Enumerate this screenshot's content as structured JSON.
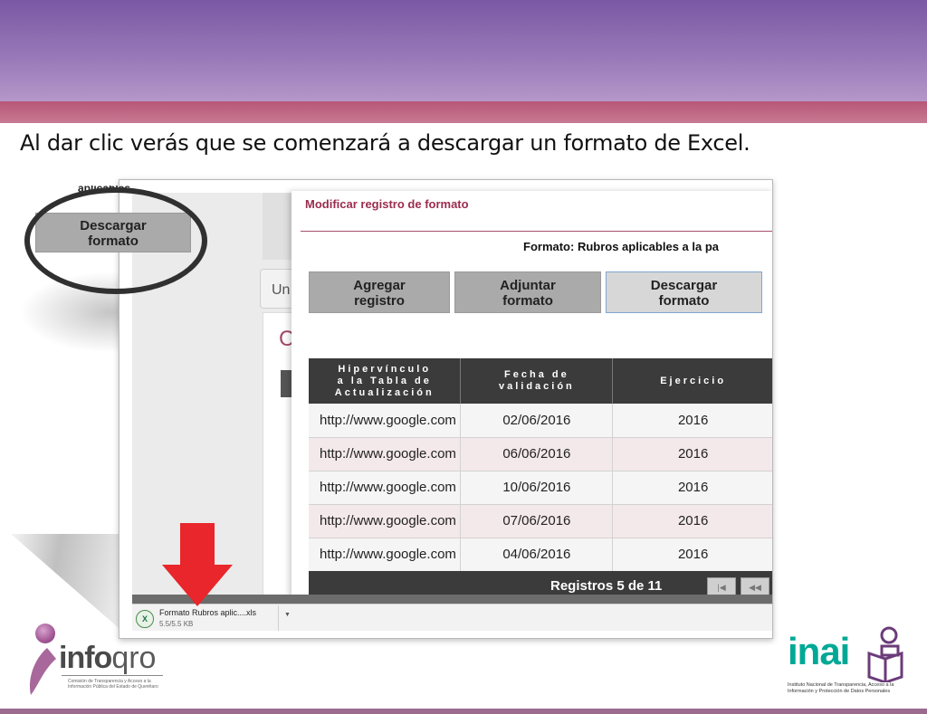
{
  "caption": "Al dar clic verás que se comenzará a descargar un formato de Excel.",
  "background_app": {
    "tab_label": "Un",
    "panel_heading_fragment": "C"
  },
  "zoom_callout": {
    "cut_text": "aplicables",
    "button_label": "Descargar\nformato"
  },
  "modal": {
    "title": "Modificar registro de formato",
    "format_label": "Formato: Rubros aplicables a la pa",
    "buttons": {
      "add": "Agregar\nregistro",
      "attach": "Adjuntar\nformato",
      "download": "Descargar\nformato"
    },
    "table": {
      "headers": [
        "Hipervínculo\na la Tabla de\nActualización",
        "Fecha de\nvalidación",
        "Ejercicio"
      ],
      "rows": [
        [
          "http://www.google.com",
          "02/06/2016",
          "2016"
        ],
        [
          "http://www.google.com",
          "06/06/2016",
          "2016"
        ],
        [
          "http://www.google.com",
          "10/06/2016",
          "2016"
        ],
        [
          "http://www.google.com",
          "07/06/2016",
          "2016"
        ],
        [
          "http://www.google.com",
          "04/06/2016",
          "2016"
        ]
      ]
    },
    "pager": {
      "text": "Registros 5 de 11",
      "first_glyph": "|◀",
      "prev_glyph": "◀◀"
    }
  },
  "download_bar": {
    "file_name": "Formato Rubros aplic....xls",
    "file_size": "5.5/5.5 KB",
    "file_icon_glyph": "X",
    "menu_glyph": "▼"
  },
  "logos": {
    "infoqro": {
      "word_a": "info",
      "word_b": "qro",
      "subtitle": "Comisión de Transparencia y Acceso a la\nInformación Pública del Estado de Querétaro"
    },
    "inai": {
      "word": "inai",
      "subtitle": "Instituto Nacional de Transparencia, Acceso a la\nInformación y Protección de Datos Personales"
    }
  },
  "colors": {
    "header_purple": "#7b58a4",
    "header_rose": "#b75677",
    "modal_title": "#9b2d4f",
    "table_header": "#3b3b3b",
    "arrow_red": "#e8262b",
    "inai_teal": "#00a896"
  },
  "icons": {
    "arrow": "down-arrow-icon",
    "file": "excel-file-icon"
  }
}
